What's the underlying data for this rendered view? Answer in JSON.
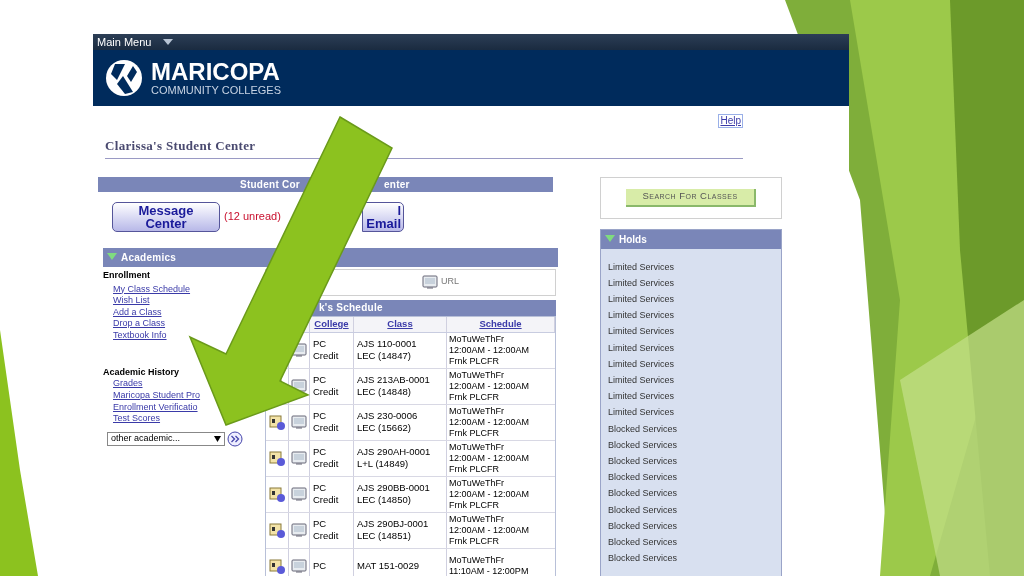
{
  "top_bar": {
    "menu": "Main Menu"
  },
  "header": {
    "logo_name": "MARICOPA",
    "logo_subtitle": "COMMUNITY COLLEGES"
  },
  "help_link": "Help",
  "page_title": "Clarissa's Student Center",
  "communication": {
    "title_left": "Student Cor",
    "title_right": "enter",
    "message_button": [
      "Message",
      "Center"
    ],
    "unread": "(12 unread)",
    "email_button": [
      "l",
      "Email"
    ]
  },
  "academics": {
    "title": "Academics",
    "expanded": true,
    "enrollment": {
      "heading": "Enrollment",
      "links": [
        "My Class Schedule",
        "Wish List",
        "Add a Class",
        "Drop a Class",
        "Textbook Info"
      ]
    },
    "history": {
      "heading": "Academic History",
      "links": [
        "Grades",
        "Maricopa Student Pro",
        "Enrollment Verificatio",
        "Test Scores"
      ]
    },
    "dropdown": {
      "value": "other academic..."
    },
    "url": "URL",
    "schedule": {
      "title": "k's Schedule",
      "columns": [
        "College",
        "Class",
        "Schedule"
      ],
      "rows": [
        {
          "college": [
            "PC",
            "Credit"
          ],
          "class": [
            "AJS 110-0001",
            "LEC (14847)"
          ],
          "schedule": [
            "MoTuWeThFr",
            "12:00AM - 12:00AM",
            "Frnk PLCFR"
          ]
        },
        {
          "college": [
            "PC",
            "Credit"
          ],
          "class": [
            "AJS 213AB-0001",
            "LEC (14848)"
          ],
          "schedule": [
            "MoTuWeThFr",
            "12:00AM - 12:00AM",
            "Frnk PLCFR"
          ]
        },
        {
          "college": [
            "PC",
            "Credit"
          ],
          "class": [
            "AJS 230-0006",
            "LEC (15662)"
          ],
          "schedule": [
            "MoTuWeThFr",
            "12:00AM - 12:00AM",
            "Frnk PLCFR"
          ]
        },
        {
          "college": [
            "PC",
            "Credit"
          ],
          "class": [
            "AJS 290AH-0001",
            "L+L (14849)"
          ],
          "schedule": [
            "MoTuWeThFr",
            "12:00AM - 12:00AM",
            "Frnk PLCFR"
          ]
        },
        {
          "college": [
            "PC",
            "Credit"
          ],
          "class": [
            "AJS 290BB-0001",
            "LEC (14850)"
          ],
          "schedule": [
            "MoTuWeThFr",
            "12:00AM - 12:00AM",
            "Frnk PLCFR"
          ]
        },
        {
          "college": [
            "PC",
            "Credit"
          ],
          "class": [
            "AJS 290BJ-0001",
            "LEC (14851)"
          ],
          "schedule": [
            "MoTuWeThFr",
            "12:00AM - 12:00AM",
            "Frnk PLCFR"
          ]
        },
        {
          "college": [
            "PC"
          ],
          "class": [
            "MAT 151-0029"
          ],
          "schedule": [
            "MoTuWeThFr",
            "11:10AM - 12:00PM"
          ]
        }
      ]
    }
  },
  "search_button": "Search For Classes",
  "holds": {
    "title": "Holds",
    "expanded": true,
    "items": [
      "Limited Services",
      "Limited Services",
      "Limited Services",
      "Limited Services",
      "Limited Services",
      "Limited Services",
      "Limited Services",
      "Limited Services",
      "Limited Services",
      "Limited Services",
      "Blocked Services",
      "Blocked Services",
      "Blocked Services",
      "Blocked Services",
      "Blocked Services",
      "Blocked Services",
      "Blocked Services",
      "Blocked Services",
      "Blocked Services"
    ]
  }
}
